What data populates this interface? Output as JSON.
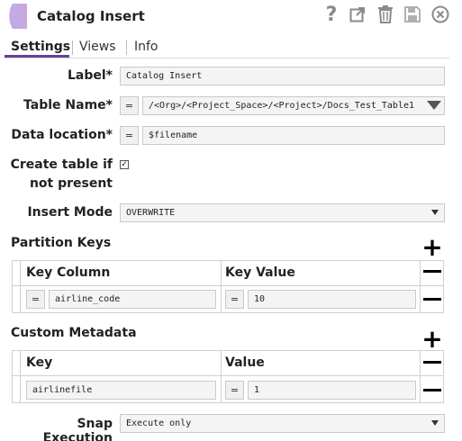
{
  "header": {
    "title": "Catalog Insert",
    "icons": [
      "snap-icon",
      "help-icon",
      "export-icon",
      "trash-icon",
      "save-icon",
      "close-icon"
    ]
  },
  "tabs": [
    {
      "label": "Settings",
      "active": true
    },
    {
      "label": "Views",
      "active": false
    },
    {
      "label": "Info",
      "active": false
    }
  ],
  "form": {
    "label": {
      "caption": "Label*",
      "value": "Catalog Insert"
    },
    "table_name": {
      "caption": "Table Name*",
      "eq": "=",
      "value": "/<Org>/<Project_Space>/<Project>/Docs_Test_Table1"
    },
    "data_location": {
      "caption": "Data location*",
      "eq": "=",
      "value": "$filename"
    },
    "create_table": {
      "caption_line1": "Create table if",
      "caption_line2": "not present",
      "checked": true,
      "check_glyph": "✓"
    },
    "insert_mode": {
      "caption": "Insert Mode",
      "value": "OVERWRITE"
    }
  },
  "partition_keys": {
    "title": "Partition Keys",
    "plus": "+",
    "columns": [
      "Key Column",
      "Key Value"
    ],
    "rows": [
      {
        "eq1": "=",
        "col": "airline_code",
        "eq2": "=",
        "val": "10"
      }
    ]
  },
  "custom_metadata": {
    "title": "Custom Metadata",
    "plus": "+",
    "columns": [
      "Key",
      "Value"
    ],
    "rows": [
      {
        "key": "airlinefile",
        "eq": "=",
        "val": "1"
      }
    ]
  },
  "snap_execution": {
    "caption": "Snap Execution",
    "value": "Execute only"
  },
  "colors": {
    "accent": "#6a3d9a",
    "snap_icon": "#c5a9e3"
  }
}
